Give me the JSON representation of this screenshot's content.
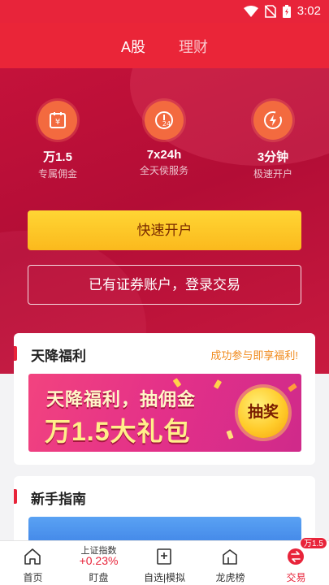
{
  "status_bar": {
    "time": "3:02"
  },
  "top_tabs": [
    {
      "label": "A股",
      "active": true
    },
    {
      "label": "理财",
      "active": false
    }
  ],
  "features": [
    {
      "icon": "yen-calendar-icon",
      "title": "万1.5",
      "subtitle": "专属佣金"
    },
    {
      "icon": "clock-24-icon",
      "title": "7x24h",
      "subtitle": "全天侯服务"
    },
    {
      "icon": "lightning-icon",
      "title": "3分钟",
      "subtitle": "极速开户"
    }
  ],
  "buttons": {
    "open_account": "快速开户",
    "login_trade": "已有证券账户，登录交易"
  },
  "welfare_card": {
    "title": "天降福利",
    "promo": "成功参与即享福利!",
    "banner_line1": "天降福利，抽佣金",
    "banner_line2": "万1.5大礼包",
    "lottery_button": "抽奖"
  },
  "guide_card": {
    "title": "新手指南"
  },
  "tab_bar": {
    "home": "首页",
    "index_name": "上证指数",
    "index_change": "+0.23%",
    "watch": "盯盘",
    "self_select": "自选|模拟",
    "dragon_tiger": "龙虎榜",
    "trade": "交易",
    "trade_badge": "万1.5"
  },
  "colors": {
    "brand_red": "#e8243a",
    "gold": "#fbb91d",
    "promo_orange": "#f08a1c"
  }
}
